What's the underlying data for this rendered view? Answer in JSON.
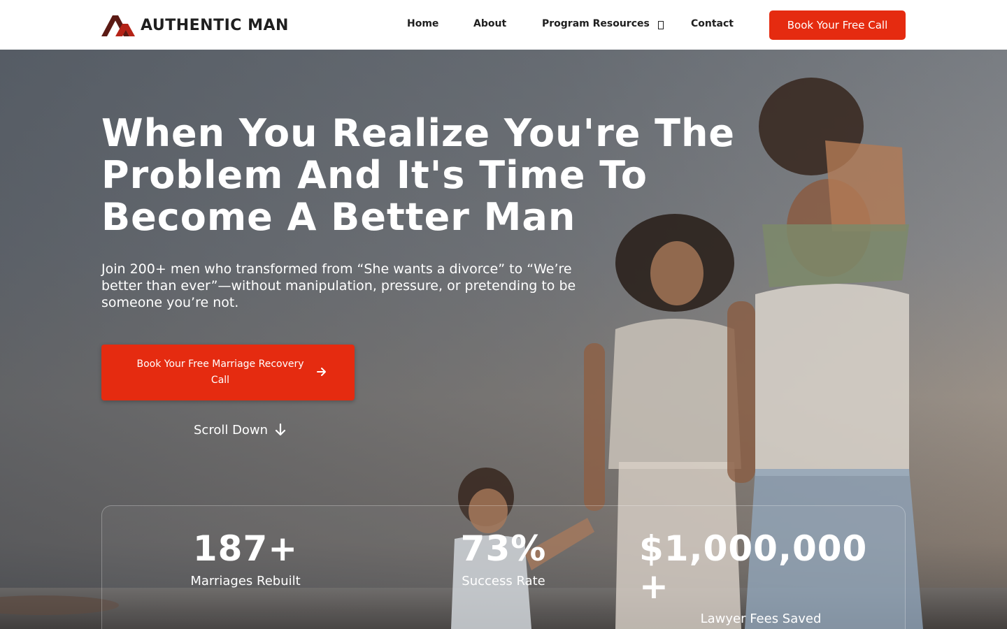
{
  "header": {
    "brand": "AUTHENTIC MAN",
    "nav": {
      "home": "Home",
      "about": "About",
      "program_resources": "Program Resources",
      "contact": "Contact"
    },
    "cta": "Book Your Free Call"
  },
  "hero": {
    "title": "When You Realize You're The Problem And It's Time To Become A Better Man",
    "subtitle": "Join 200+ men who transformed from “She wants a divorce” to “We’re better than ever”—without manipulation, pressure, or pretending to be someone you’re not.",
    "cta": "Book Your Free Marriage Recovery Call",
    "scroll": "Scroll Down"
  },
  "stats": [
    {
      "value": "187+",
      "label": "Marriages Rebuilt"
    },
    {
      "value": "73%",
      "label": "Success Rate"
    },
    {
      "value": "$1,000,000 +",
      "label": "Lawyer Fees Saved"
    }
  ],
  "colors": {
    "accent": "#e52b10",
    "logo_dark": "#5b1a14",
    "logo_red": "#b52317",
    "text_dark": "#1f1f1f"
  },
  "icons": [
    "logo-mark-icon",
    "chevron-down-icon",
    "arrow-right-icon",
    "arrow-down-icon"
  ]
}
